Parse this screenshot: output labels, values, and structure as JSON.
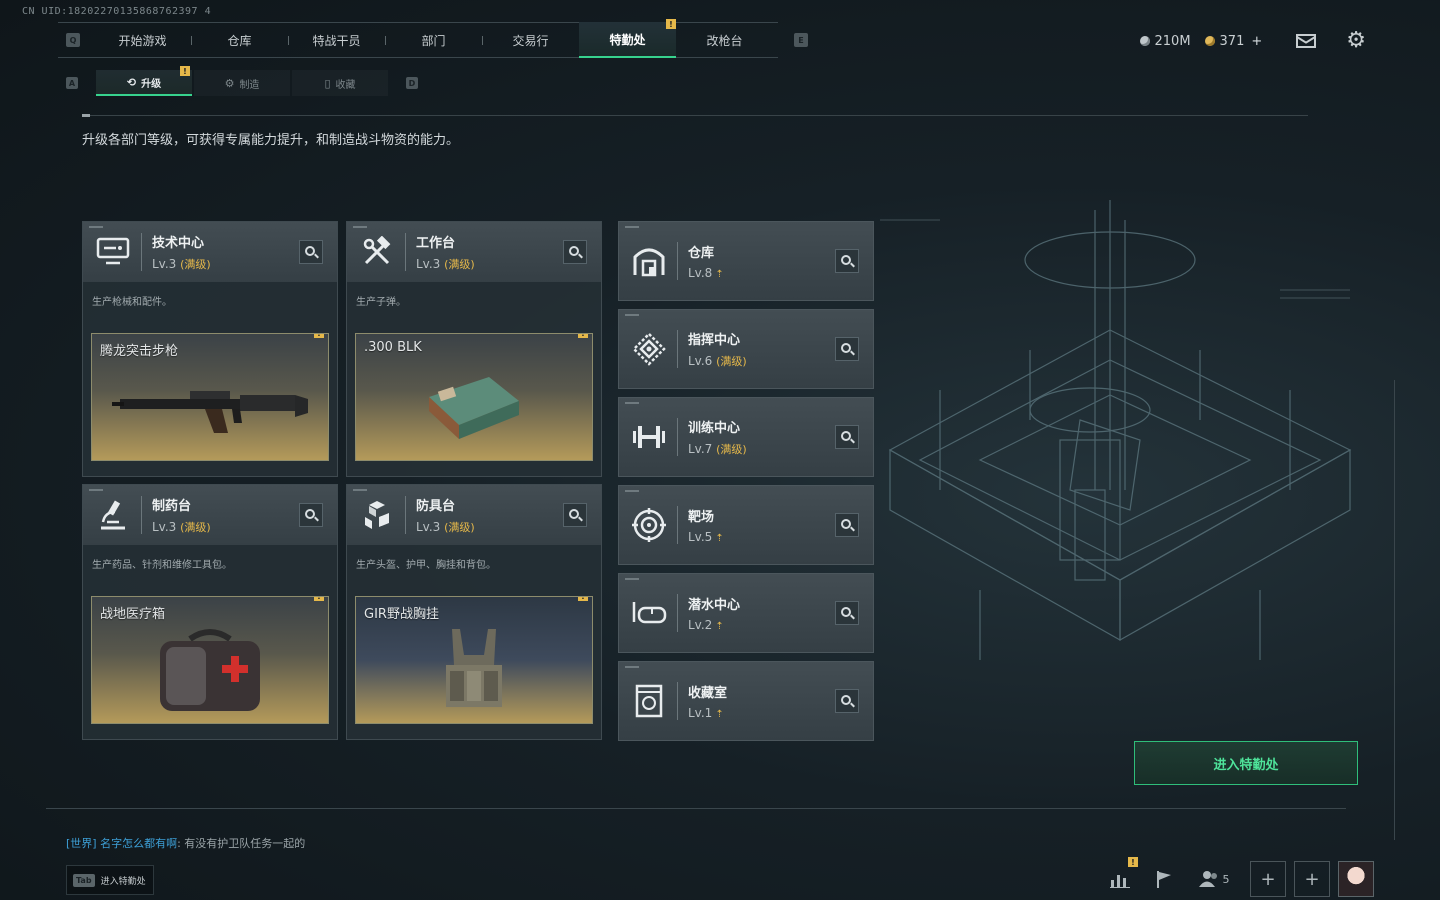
{
  "uid_text": "CN UID:18202270135868762397 4",
  "nav": {
    "left_key": "Q",
    "right_key": "E",
    "tabs": [
      {
        "label": "开始游戏",
        "active": false
      },
      {
        "label": "仓库",
        "active": false
      },
      {
        "label": "特战干员",
        "active": false
      },
      {
        "label": "部门",
        "active": false
      },
      {
        "label": "交易行",
        "active": false
      },
      {
        "label": "特勤处",
        "active": true,
        "badge": "!"
      },
      {
        "label": "改枪台",
        "active": false
      }
    ]
  },
  "status": {
    "currency_1": "210M",
    "currency_2": "371",
    "currency_2_plus": "+"
  },
  "subnav": {
    "left_key": "A",
    "right_key": "D",
    "tabs": [
      {
        "label": "升级",
        "active": true,
        "badge": "!"
      },
      {
        "label": "制造",
        "active": false
      },
      {
        "label": "收藏",
        "active": false
      }
    ]
  },
  "description": "升级各部门等级，可获得专属能力提升，和制造战斗物资的能力。",
  "departments": [
    {
      "name": "技术中心",
      "level": "Lv.3",
      "maxed": "(满级)",
      "desc": "生产枪械和配件。",
      "product": "腾龙突击步枪",
      "product_badge": "!",
      "icon": "monitor-icon"
    },
    {
      "name": "工作台",
      "level": "Lv.3",
      "maxed": "(满级)",
      "desc": "生产子弹。",
      "product": ".300 BLK",
      "product_badge": "!",
      "icon": "hammer-wrench-icon"
    },
    {
      "name": "制药台",
      "level": "Lv.3",
      "maxed": "(满级)",
      "desc": "生产药品、针剂和维修工具包。",
      "product": "战地医疗箱",
      "product_badge": "!",
      "icon": "microscope-icon"
    },
    {
      "name": "防具台",
      "level": "Lv.3",
      "maxed": "(满级)",
      "desc": "生产头盔、护甲、胸挂和背包。",
      "product": "GIR野战胸挂",
      "product_badge": "!",
      "icon": "cubes-icon"
    }
  ],
  "facilities": [
    {
      "name": "仓库",
      "level": "Lv.8",
      "maxed": "",
      "upgradable": true,
      "icon": "warehouse-icon"
    },
    {
      "name": "指挥中心",
      "level": "Lv.6",
      "maxed": "(满级)",
      "upgradable": false,
      "icon": "command-icon"
    },
    {
      "name": "训练中心",
      "level": "Lv.7",
      "maxed": "(满级)",
      "upgradable": false,
      "icon": "dumbbell-icon"
    },
    {
      "name": "靶场",
      "level": "Lv.5",
      "maxed": "",
      "upgradable": true,
      "icon": "target-icon"
    },
    {
      "name": "潜水中心",
      "level": "Lv.2",
      "maxed": "",
      "upgradable": true,
      "icon": "goggles-icon"
    },
    {
      "name": "收藏室",
      "level": "Lv.1",
      "maxed": "",
      "upgradable": true,
      "icon": "collection-icon"
    }
  ],
  "enter_button": "进入特勤处",
  "chat": {
    "channel": "[世界]",
    "name": "名字怎么都有啊",
    "message": ": 有没有护卫队任务一起的"
  },
  "tab_hint": {
    "key": "Tab",
    "label": "进入特勤处"
  },
  "bottom": {
    "friends_count": "5",
    "stats_badge": "!"
  },
  "accent": "#37d38e",
  "warn": "#e5b84a"
}
